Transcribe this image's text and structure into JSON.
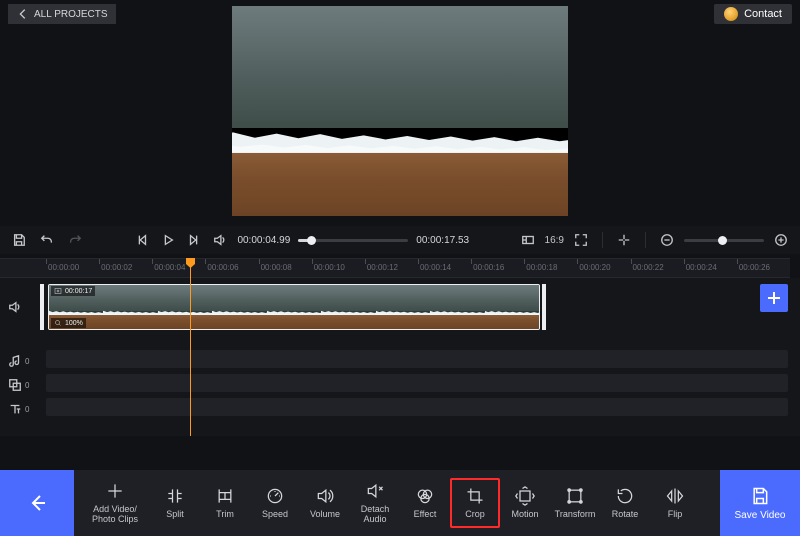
{
  "header": {
    "all_projects_label": "ALL PROJECTS",
    "contact_label": "Contact"
  },
  "playback": {
    "current_time": "00:00:04.99",
    "total_time": "00:00:17.53",
    "aspect_ratio": "16:9"
  },
  "ruler": {
    "marks": [
      "00:00:00",
      "00:00:02",
      "00:00:04",
      "00:00:06",
      "00:00:08",
      "00:00:10",
      "00:00:12",
      "00:00:14",
      "00:00:16",
      "00:00:18",
      "00:00:20",
      "00:00:22",
      "00:00:24",
      "00:00:26"
    ]
  },
  "clip": {
    "duration_label": "00:00:17",
    "zoom_label": "100%"
  },
  "track_counts": {
    "music": "0",
    "overlay": "0",
    "text": "0"
  },
  "tools": {
    "add": "Add Video/\nPhoto Clips",
    "split": "Split",
    "trim": "Trim",
    "speed": "Speed",
    "volume": "Volume",
    "detach": "Detach\nAudio",
    "effect": "Effect",
    "crop": "Crop",
    "motion": "Motion",
    "transform": "Transform",
    "rotate": "Rotate",
    "flip": "Flip"
  },
  "save_label": "Save Video"
}
